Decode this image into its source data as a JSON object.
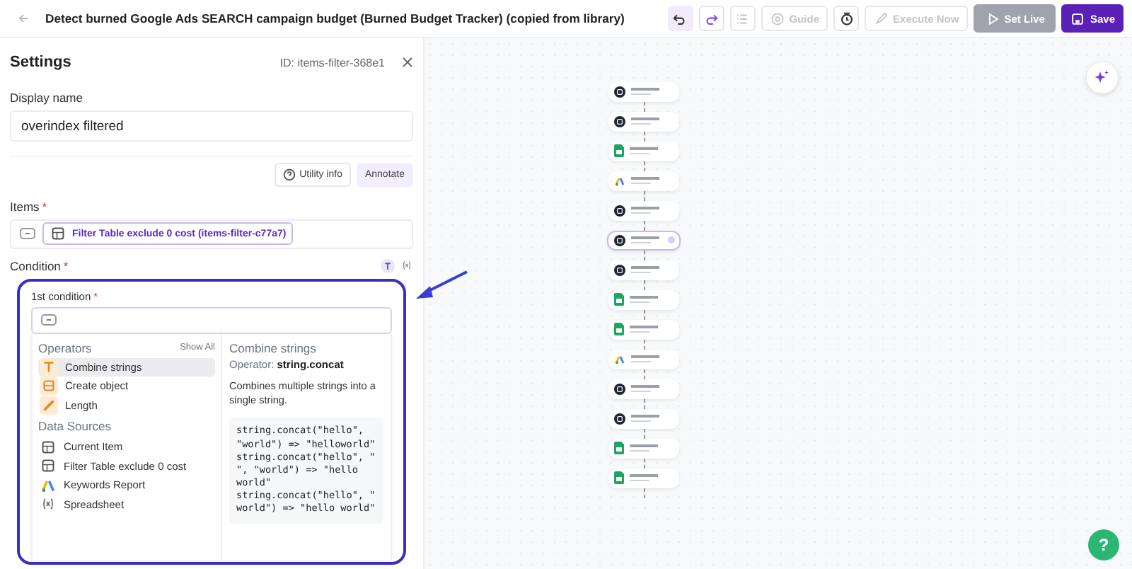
{
  "header": {
    "title": "Detect burned Google Ads SEARCH campaign budget (Burned Budget Tracker) (copied from library)"
  },
  "toolbar": [
    {
      "kind": "undo",
      "disabled": false
    },
    {
      "kind": "redo",
      "disabled": false
    },
    {
      "kind": "list",
      "disabled": true
    },
    {
      "kind": "guide",
      "label": "Guide",
      "disabled": true
    },
    {
      "kind": "clock",
      "disabled": false
    },
    {
      "kind": "execute",
      "label": "Execute Now",
      "disabled": true
    },
    {
      "kind": "setlive",
      "label": "Set Live",
      "disabled": true
    },
    {
      "kind": "save",
      "label": "Save",
      "disabled": false
    }
  ],
  "settings": {
    "title": "Settings",
    "id_label": "ID: items-filter-368e1",
    "display_name": {
      "label": "Display name",
      "value": "overindex filtered"
    },
    "buttons": [
      {
        "kind": "info",
        "label": "Utility info"
      },
      {
        "kind": "annotate",
        "label": "Annotate"
      }
    ],
    "items": {
      "label": "Items",
      "required_mark": "*",
      "chip": "Filter Table exclude 0 cost (items-filter-c77a7)"
    },
    "condition": {
      "label": "Condition",
      "required_mark": "*",
      "condition_label": "1st condition",
      "condition_mark": "*",
      "operators": {
        "title": "Operators",
        "show_all": "Show All",
        "items": [
          {
            "kind": "text",
            "label": "Combine strings",
            "selected": true
          },
          {
            "kind": "object",
            "label": "Create object",
            "selected": false
          },
          {
            "kind": "ruler",
            "label": "Length",
            "selected": false
          }
        ]
      },
      "data_sources": {
        "title": "Data Sources",
        "items": [
          {
            "kind": "table",
            "label": "Current Item"
          },
          {
            "kind": "table",
            "label": "Filter Table exclude 0 cost"
          },
          {
            "kind": "ads",
            "label": "Keywords Report"
          },
          {
            "kind": "variable",
            "label": "Spreadsheet"
          }
        ]
      },
      "detail": {
        "title": "Combine strings",
        "operator_label": "Operator:",
        "operator": "string.concat",
        "description": "Combines multiple strings into a single string.",
        "example": [
          "string.concat(\"hello\",",
          "\"world\") => \"helloworld\"",
          "string.concat(\"hello\", \"",
          "\", \"world\") => \"hello",
          "world\"",
          "string.concat(\"hello\", \"",
          "world\") => \"hello world\""
        ]
      }
    }
  },
  "canvas": {
    "nodes": [
      {
        "kind": "step",
        "selected": false
      },
      {
        "kind": "step",
        "selected": false
      },
      {
        "kind": "sheets",
        "selected": false
      },
      {
        "kind": "ads",
        "selected": false
      },
      {
        "kind": "step",
        "selected": false
      },
      {
        "kind": "step",
        "selected": true
      },
      {
        "kind": "step",
        "selected": false
      },
      {
        "kind": "sheets",
        "selected": false
      },
      {
        "kind": "sheets",
        "selected": false
      },
      {
        "kind": "ads",
        "selected": false
      },
      {
        "kind": "step",
        "selected": false
      },
      {
        "kind": "step",
        "selected": false
      },
      {
        "kind": "sheets",
        "selected": false
      },
      {
        "kind": "sheets",
        "selected": false
      }
    ],
    "help": "?"
  }
}
